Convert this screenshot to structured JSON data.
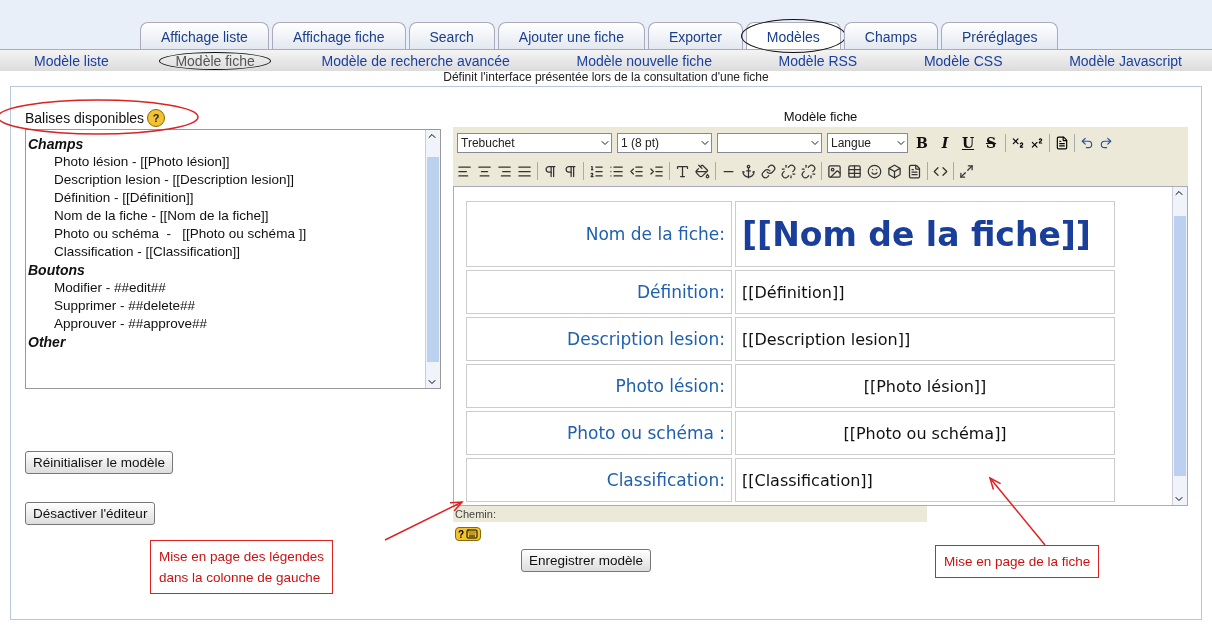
{
  "tabs": [
    {
      "label": "Affichage liste",
      "selected": false
    },
    {
      "label": "Affichage fiche",
      "selected": false
    },
    {
      "label": "Search",
      "selected": false
    },
    {
      "label": "Ajouter une fiche",
      "selected": false
    },
    {
      "label": "Exporter",
      "selected": false
    },
    {
      "label": "Modèles",
      "selected": true
    },
    {
      "label": "Champs",
      "selected": false
    },
    {
      "label": "Préréglages",
      "selected": false
    }
  ],
  "subtabs": [
    {
      "label": "Modèle liste",
      "selected": false
    },
    {
      "label": "Modèle fiche",
      "selected": true
    },
    {
      "label": "Modèle de recherche avancée",
      "selected": false
    },
    {
      "label": "Modèle nouvelle fiche",
      "selected": false
    },
    {
      "label": "Modèle RSS",
      "selected": false
    },
    {
      "label": "Modèle CSS",
      "selected": false
    },
    {
      "label": "Modèle Javascript",
      "selected": false
    }
  ],
  "description": "Définit l'interface présentée lors de la consultation d'une fiche",
  "tags_panel": {
    "title": "Balises disponibles",
    "help": "?",
    "groups": [
      {
        "label": "Champs",
        "items": [
          "Photo lésion - [[Photo lésion]]",
          "Description lesion - [[Description lesion]]",
          "Définition - [[Définition]]",
          "Nom de la fiche - [[Nom de la fiche]]",
          "Photo ou schéma  -   [[Photo ou schéma ]]",
          "Classification - [[Classification]]"
        ]
      },
      {
        "label": "Boutons",
        "items": [
          "Modifier - ##edit##",
          "Supprimer - ##delete##",
          "Approuver - ##approve##"
        ]
      },
      {
        "label": "Other"
      }
    ]
  },
  "left_buttons": [
    "Réinitialiser le modèle",
    "Désactiver l'éditeur"
  ],
  "editor": {
    "title": "Modèle fiche",
    "font": "Trebuchet",
    "size": "1 (8 pt)",
    "language": "Langue",
    "format_buttons": [
      "B",
      "I",
      "U",
      "S"
    ],
    "rows": [
      {
        "label": "Nom de la fiche:",
        "value": "[[Nom de la fiche]]",
        "kind": "title",
        "centered": false
      },
      {
        "label": "Définition:",
        "value": "[[Définition]]",
        "kind": "field",
        "centered": false
      },
      {
        "label": "Description lesion:",
        "value": "[[Description lesion]]",
        "kind": "field",
        "centered": false
      },
      {
        "label": "Photo lésion:",
        "value": "[[Photo lésion]]",
        "kind": "field",
        "centered": true
      },
      {
        "label": "Photo ou schéma :",
        "value": "[[Photo ou schéma]]",
        "kind": "field",
        "centered": true
      },
      {
        "label": "Classification:",
        "value": "[[Classification]]",
        "kind": "field",
        "centered": false
      }
    ],
    "path_label": "Chemin:",
    "help": "?"
  },
  "save_button": "Enregistrer modèle",
  "callouts": [
    "Mise en page des légendes\ndans la colonne de gauche",
    "Mise en page de la fiche"
  ]
}
